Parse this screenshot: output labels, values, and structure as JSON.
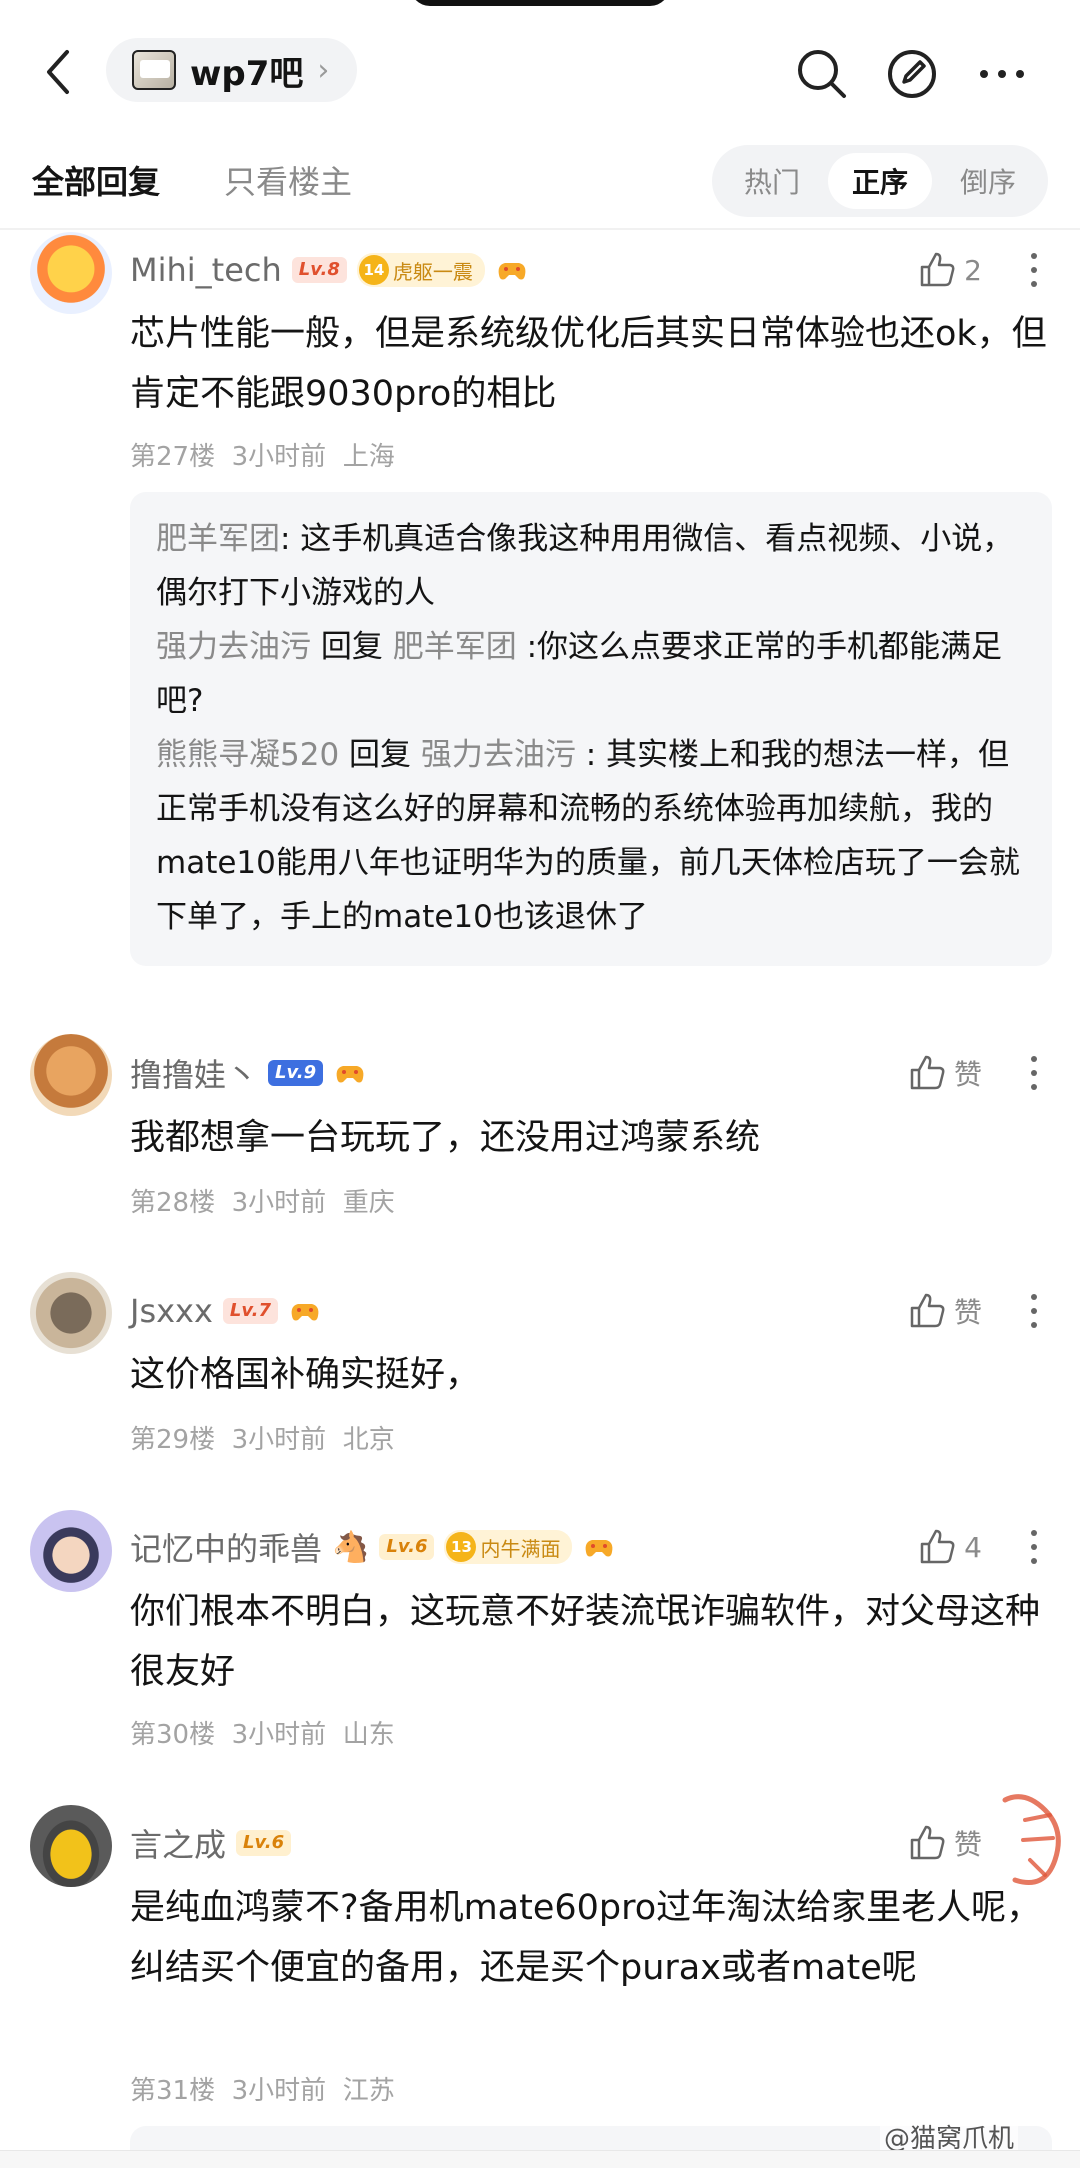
{
  "header": {
    "forum_name": "wp7吧",
    "forum_chevron": "›"
  },
  "tabs": {
    "all_replies": "全部回复",
    "op_only": "只看楼主"
  },
  "sort": {
    "hot": "热门",
    "asc": "正序",
    "desc": "倒序",
    "selected": "正序"
  },
  "comments": [
    {
      "user": "Mihi_tech",
      "level": "Lv.8",
      "badge_num": "14",
      "badge_text": "虎躯一震",
      "likes": "2",
      "text": "芯片性能一般，但是系统级优化后其实日常体验也还ok，但肯定不能跟9030pro的相比",
      "floor": "第27楼",
      "time": "3小时前",
      "location": "上海",
      "replies": [
        {
          "from": "肥羊军团",
          "verb": "",
          "to": "",
          "text": ": 这手机真适合像我这种用用微信、看点视频、小说，偶尔打下小游戏的人"
        },
        {
          "from": "强力去油污",
          "verb": " 回复 ",
          "to": "肥羊军团",
          "text": " :你这么点要求正常的手机都能满足吧?"
        },
        {
          "from": "熊熊寻凝520",
          "verb": " 回复 ",
          "to": "强力去油污",
          "text": " : 其实楼上和我的想法一样，但正常手机没有这么好的屏幕和流畅的系统体验再加续航，我的mate10能用八年也证明华为的质量，前几天体检店玩了一会就下单了，手上的mate10也该退休了"
        }
      ]
    },
    {
      "user": "撸撸娃丶",
      "level": "Lv.9",
      "likes": "赞",
      "text": "我都想拿一台玩玩了，还没用过鸿蒙系统",
      "floor": "第28楼",
      "time": "3小时前",
      "location": "重庆"
    },
    {
      "user": "Jsxxx",
      "level": "Lv.7",
      "likes": "赞",
      "text": "这价格国补确实挺好，",
      "floor": "第29楼",
      "time": "3小时前",
      "location": "北京"
    },
    {
      "user": "记忆中的乖兽",
      "level": "Lv.6",
      "badge_num": "13",
      "badge_text": "内牛满面",
      "likes": "4",
      "text": "你们根本不明白，这玩意不好装流氓诈骗软件，对父母这种很友好",
      "floor": "第30楼",
      "time": "3小时前",
      "location": "山东"
    },
    {
      "user": "言之成",
      "level": "Lv.6",
      "likes": "赞",
      "text": "是纯血鸿蒙不?备用机mate60pro过年淘汰给家里老人呢，纠结买个便宜的备用，还是买个purax或者mate呢",
      "floor": "第31楼",
      "time": "3小时前",
      "location": "江苏"
    }
  ],
  "watermark": "@猫窝爪机",
  "colors": {
    "level_red": "#e0502d",
    "level_blue": "#3d6fe0",
    "level_orange": "#d9820a",
    "badge_gold": "#f5b419",
    "meta_gray": "#a3a3a3"
  }
}
